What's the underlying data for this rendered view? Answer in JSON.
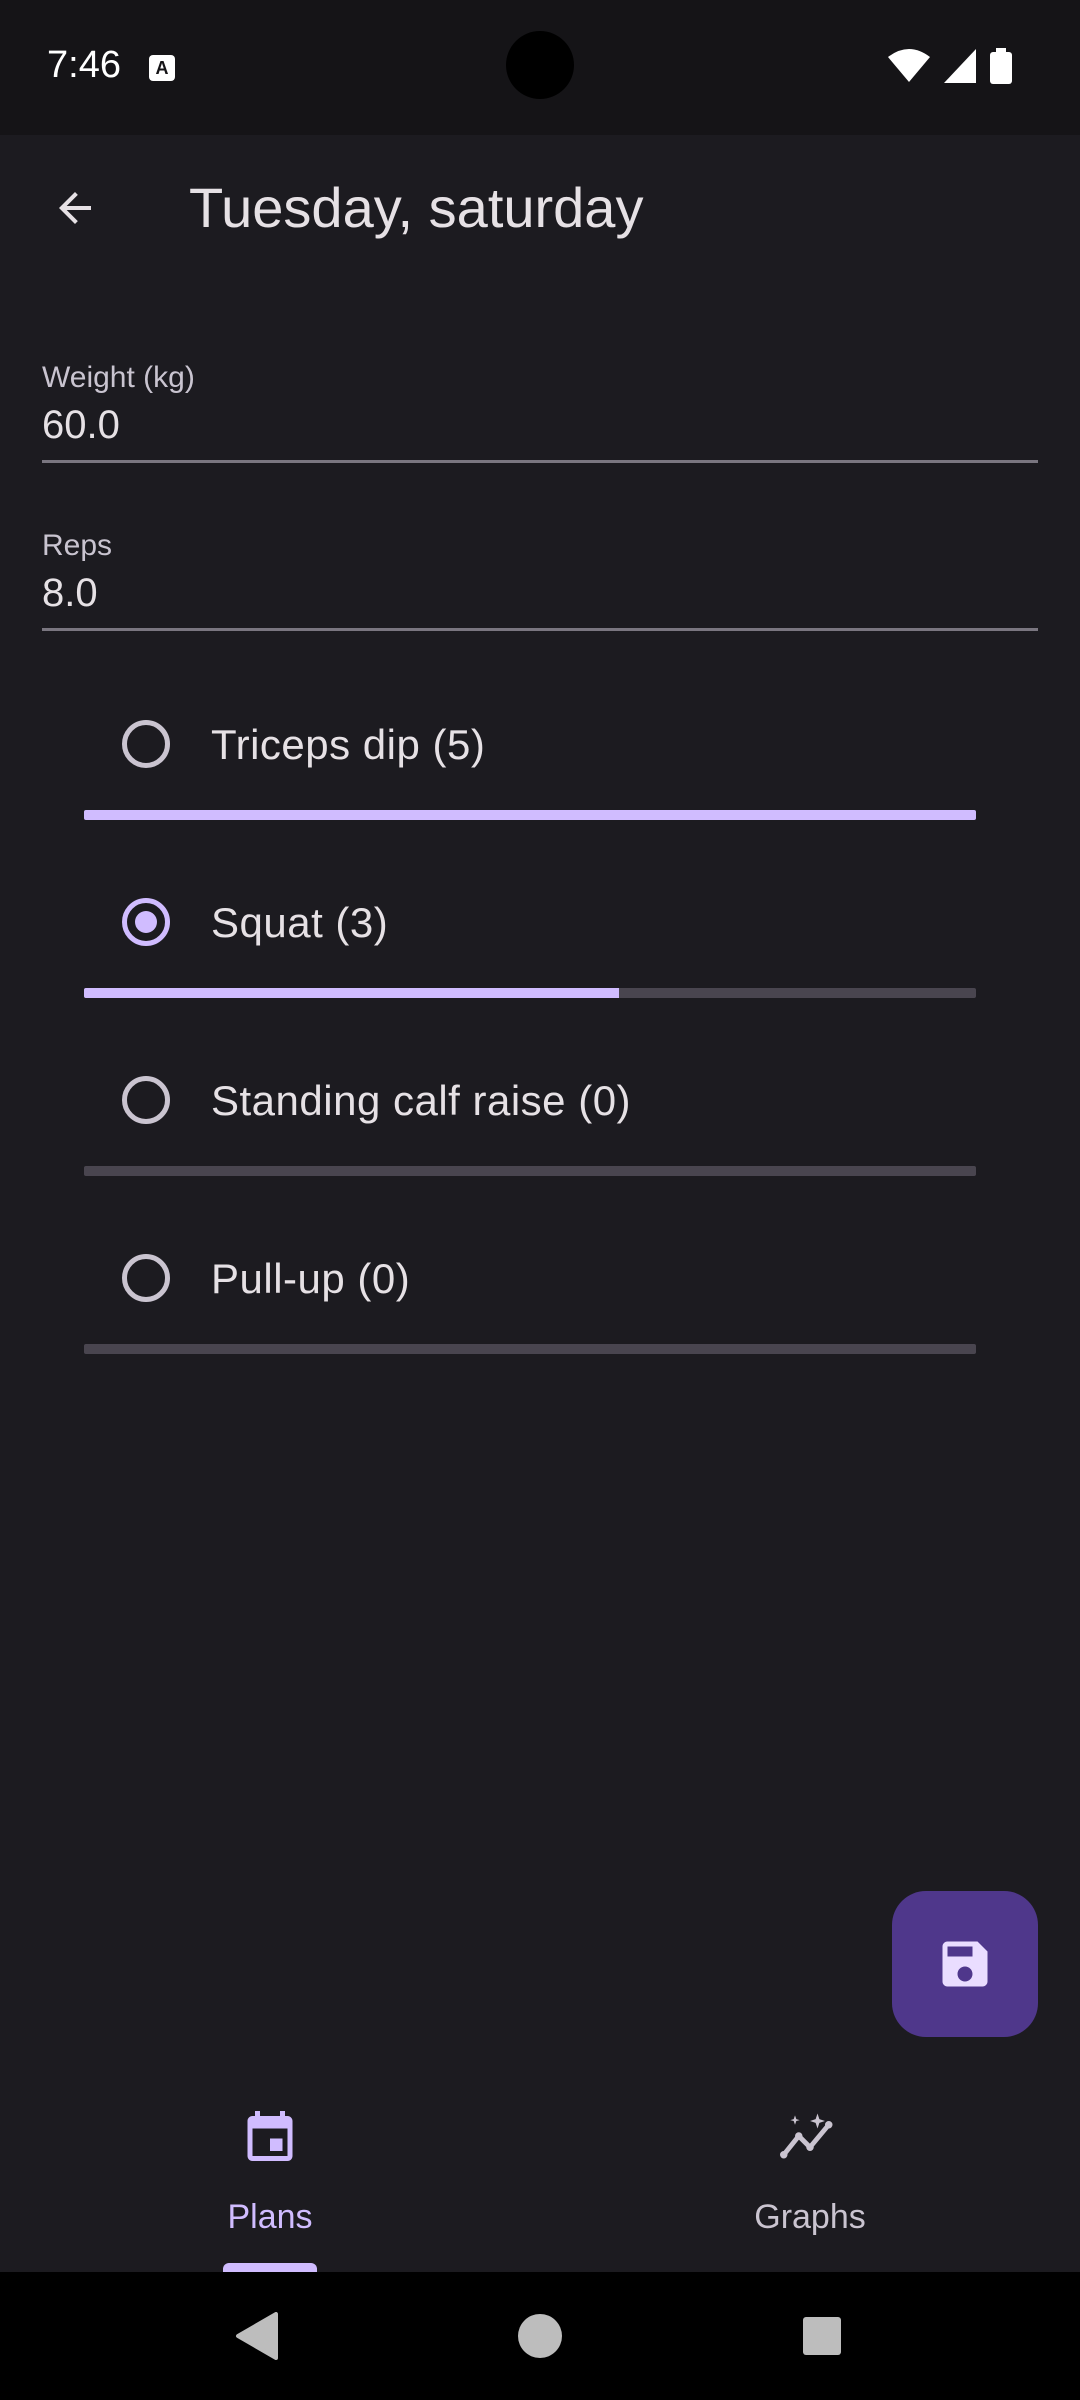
{
  "status_bar": {
    "time": "7:46",
    "notification_icon": "text-a-icon",
    "icons": [
      "wifi-icon",
      "signal-icon",
      "battery-icon"
    ]
  },
  "app_bar": {
    "title": "Tuesday, saturday",
    "back_icon": "arrow-back-icon"
  },
  "fields": {
    "weight": {
      "label": "Weight (kg)",
      "value": "60.0"
    },
    "reps": {
      "label": "Reps",
      "value": "8.0"
    }
  },
  "exercises": [
    {
      "label": "Triceps dip (5)",
      "selected": false,
      "progress": 1.0
    },
    {
      "label": "Squat (3)",
      "selected": true,
      "progress": 0.6
    },
    {
      "label": "Standing calf raise (0)",
      "selected": false,
      "progress": 0.0
    },
    {
      "label": "Pull-up (0)",
      "selected": false,
      "progress": 0.0
    }
  ],
  "fab": {
    "icon": "save-icon"
  },
  "bottom_nav": {
    "items": [
      {
        "label": "Plans",
        "icon": "calendar-icon",
        "active": true
      },
      {
        "label": "Graphs",
        "icon": "insights-icon",
        "active": false
      }
    ]
  },
  "colors": {
    "accent": "#d0bcff",
    "fab": "#4f378b",
    "background": "#1c1b20"
  }
}
